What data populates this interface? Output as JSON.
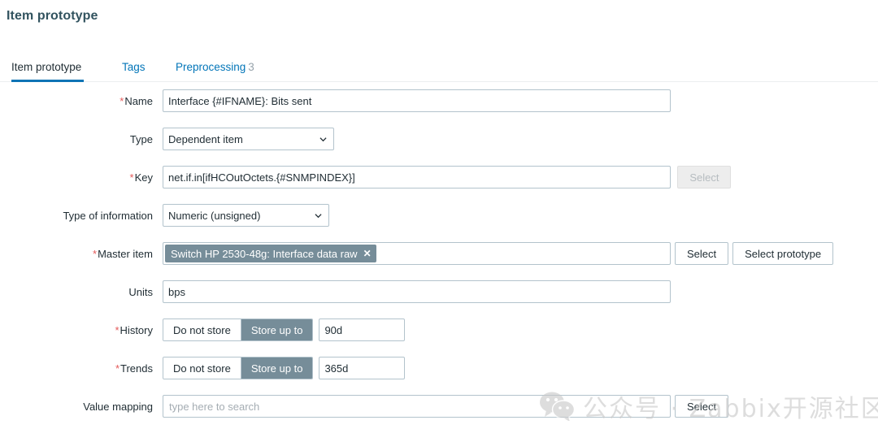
{
  "page": {
    "title": "Item prototype"
  },
  "tabs": [
    {
      "label": "Item prototype",
      "count": "",
      "active": true
    },
    {
      "label": "Tags",
      "count": "",
      "active": false
    },
    {
      "label": "Preprocessing",
      "count": "3",
      "active": false
    }
  ],
  "form": {
    "name": {
      "label": "Name",
      "required": true,
      "value": "Interface {#IFNAME}: Bits sent",
      "placeholder": ""
    },
    "type": {
      "label": "Type",
      "required": false,
      "value": "Dependent item"
    },
    "key": {
      "label": "Key",
      "required": true,
      "value": "net.if.in[ifHCOutOctets.{#SNMPINDEX}]",
      "placeholder": "",
      "select_label": "Select",
      "select_disabled": true
    },
    "type_of_information": {
      "label": "Type of information",
      "required": false,
      "value": "Numeric (unsigned)"
    },
    "master_item": {
      "label": "Master item",
      "required": true,
      "chip": "Switch HP 2530-48g: Interface data raw",
      "chip_remove": "✕",
      "select_label": "Select",
      "select_prototype_label": "Select prototype"
    },
    "units": {
      "label": "Units",
      "required": false,
      "value": "bps",
      "placeholder": ""
    },
    "history": {
      "label": "History",
      "required": true,
      "options": [
        "Do not store",
        "Store up to"
      ],
      "selected": "Store up to",
      "value": "90d"
    },
    "trends": {
      "label": "Trends",
      "required": true,
      "options": [
        "Do not store",
        "Store up to"
      ],
      "selected": "Store up to",
      "value": "365d"
    },
    "value_mapping": {
      "label": "Value mapping",
      "required": false,
      "value": "",
      "placeholder": "type here to search",
      "select_label": "Select"
    }
  },
  "watermark": {
    "text": "公众号 · Zabbix开源社区",
    "icon": "wechat-icon"
  },
  "colors": {
    "accent_blue": "#0275b8",
    "tab_underline": "#0f74b5",
    "title": "#32535f",
    "required_asterisk": "#e45959",
    "chip_bg": "#768d99",
    "segment_selected_bg": "#768d99",
    "input_border": "#b3c3cc",
    "watermark": "#c9c9c9"
  }
}
